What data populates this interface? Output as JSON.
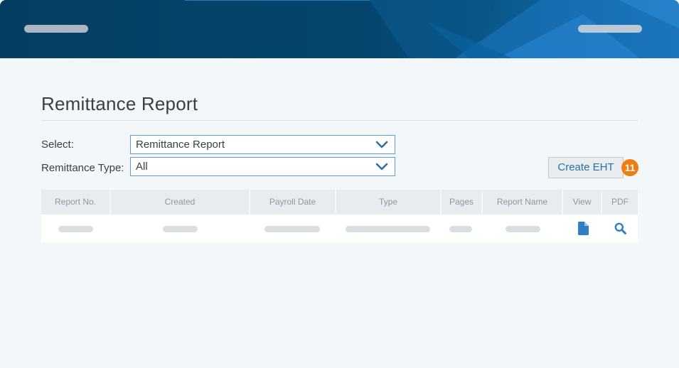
{
  "page": {
    "title": "Remittance Report"
  },
  "form": {
    "select_label": "Select:",
    "select_value": "Remittance Report",
    "type_label": "Remittance Type:",
    "type_value": "All"
  },
  "actions": {
    "create_label": "Create EHT",
    "badge_number": "11"
  },
  "table": {
    "columns": [
      "Report No.",
      "Created",
      "Payroll Date",
      "Type",
      "Pages",
      "Report Name",
      "View",
      "PDF"
    ],
    "row_icons": {
      "view": "document-icon",
      "pdf": "magnifier-icon"
    }
  },
  "colors": {
    "header_dark": "#044469",
    "header_light": "#2583cf",
    "accent": "#2e6fa3",
    "badge": "#f07d10",
    "background": "#f3f7fa"
  }
}
